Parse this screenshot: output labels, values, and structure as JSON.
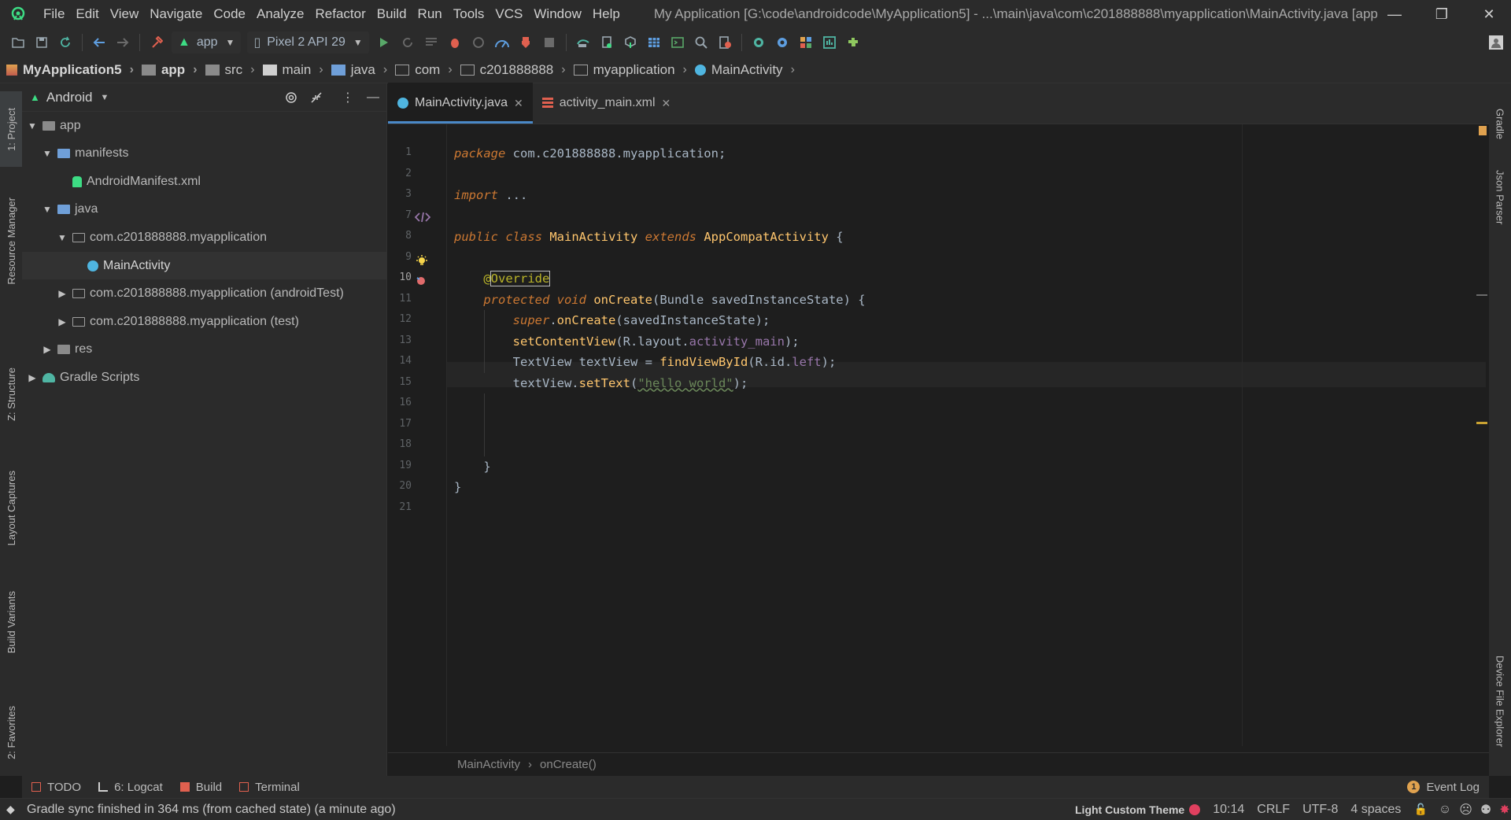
{
  "window": {
    "title": "My Application [G:\\code\\androidcode\\MyApplication5] - ...\\main\\java\\com\\c201888888\\myapplication\\MainActivity.java [app",
    "controls": {
      "minimize": "—",
      "restore": "❐",
      "close": "✕"
    }
  },
  "menu": [
    "File",
    "Edit",
    "View",
    "Navigate",
    "Code",
    "Analyze",
    "Refactor",
    "Build",
    "Run",
    "Tools",
    "VCS",
    "Window",
    "Help"
  ],
  "toolbar": {
    "run_config": "app",
    "device": "Pixel 2 API 29"
  },
  "breadcrumbs": [
    "MyApplication5",
    "app",
    "src",
    "main",
    "java",
    "com",
    "c201888888",
    "myapplication",
    "MainActivity"
  ],
  "left_strip": [
    "1: Project",
    "Resource Manager",
    "Z: Structure",
    "Layout Captures",
    "Build Variants",
    "2: Favorites"
  ],
  "right_strip": [
    "Gradle",
    "Json Parser",
    "Device File Explorer"
  ],
  "project": {
    "view": "Android",
    "tree": [
      {
        "label": "app",
        "depth": 0,
        "arrow": "▼",
        "icon": "folder-gray"
      },
      {
        "label": "manifests",
        "depth": 1,
        "arrow": "▼",
        "icon": "folder-blue"
      },
      {
        "label": "AndroidManifest.xml",
        "depth": 2,
        "arrow": "",
        "icon": "android"
      },
      {
        "label": "java",
        "depth": 1,
        "arrow": "▼",
        "icon": "folder-blue"
      },
      {
        "label": "com.c201888888.myapplication",
        "depth": 2,
        "arrow": "▼",
        "icon": "folder-outline"
      },
      {
        "label": "MainActivity",
        "depth": 3,
        "arrow": "",
        "icon": "class",
        "selected": true
      },
      {
        "label": "com.c201888888.myapplication (androidTest)",
        "depth": 2,
        "arrow": "▶",
        "icon": "folder-outline"
      },
      {
        "label": "com.c201888888.myapplication (test)",
        "depth": 2,
        "arrow": "▶",
        "icon": "folder-outline"
      },
      {
        "label": "res",
        "depth": 1,
        "arrow": "▶",
        "icon": "folder-gray"
      },
      {
        "label": "Gradle Scripts",
        "depth": 0,
        "arrow": "▶",
        "icon": "gradle"
      }
    ]
  },
  "editor": {
    "tabs": [
      {
        "label": "MainActivity.java",
        "active": true
      },
      {
        "label": "activity_main.xml",
        "active": false
      }
    ],
    "current_line": 10,
    "lines": [
      {
        "n": "1",
        "parts": [
          [
            "kw",
            "package"
          ],
          [
            "plain",
            " com.c201888888.myapplication;"
          ]
        ]
      },
      {
        "n": "2",
        "parts": []
      },
      {
        "n": "3",
        "parts": [
          [
            "kw",
            "import"
          ],
          [
            "plain",
            " ..."
          ]
        ]
      },
      {
        "n": "7",
        "parts": []
      },
      {
        "n": "8",
        "parts": [
          [
            "kw",
            "public class"
          ],
          [
            "plain",
            " "
          ],
          [
            "cls",
            "MainActivity"
          ],
          [
            "plain",
            " "
          ],
          [
            "kw",
            "extends"
          ],
          [
            "plain",
            " "
          ],
          [
            "cls",
            "AppCompatActivity"
          ],
          [
            "plain",
            " {"
          ]
        ]
      },
      {
        "n": "9",
        "parts": []
      },
      {
        "n": "10",
        "parts": [
          [
            "ann",
            "    @"
          ],
          [
            "ann",
            "Override"
          ]
        ]
      },
      {
        "n": "11",
        "parts": [
          [
            "kw",
            "    protected void"
          ],
          [
            "plain",
            " "
          ],
          [
            "fn",
            "onCreate"
          ],
          [
            "plain",
            "(Bundle savedInstanceState) {"
          ]
        ]
      },
      {
        "n": "12",
        "parts": [
          [
            "kw",
            "        super"
          ],
          [
            "plain",
            "."
          ],
          [
            "fn",
            "onCreate"
          ],
          [
            "plain",
            "(savedInstanceState);"
          ]
        ]
      },
      {
        "n": "13",
        "parts": [
          [
            "plain",
            "        "
          ],
          [
            "fn",
            "setContentView"
          ],
          [
            "plain",
            "(R.layout."
          ],
          [
            "fld",
            "activity_main"
          ],
          [
            "plain",
            ");"
          ]
        ]
      },
      {
        "n": "14",
        "parts": [
          [
            "plain",
            "        TextView textView = "
          ],
          [
            "fn",
            "findViewById"
          ],
          [
            "plain",
            "(R.id."
          ],
          [
            "fld",
            "left"
          ],
          [
            "plain",
            ");"
          ]
        ]
      },
      {
        "n": "15",
        "parts": [
          [
            "plain",
            "        textView."
          ],
          [
            "fn",
            "setText"
          ],
          [
            "plain",
            "("
          ],
          [
            "str",
            "\"hello world\""
          ],
          [
            "plain",
            ");"
          ]
        ]
      },
      {
        "n": "16",
        "parts": []
      },
      {
        "n": "17",
        "parts": []
      },
      {
        "n": "18",
        "parts": []
      },
      {
        "n": "19",
        "parts": [
          [
            "plain",
            "    }"
          ]
        ]
      },
      {
        "n": "20",
        "parts": [
          [
            "plain",
            "}"
          ]
        ]
      },
      {
        "n": "21",
        "parts": []
      }
    ],
    "breadcrumb": [
      "MainActivity",
      "onCreate()"
    ]
  },
  "bottom_tabs": [
    {
      "label": "TODO",
      "icon": "todo-icon"
    },
    {
      "label": "6: Logcat",
      "icon": "logcat-icon"
    },
    {
      "label": "Build",
      "icon": "build-icon"
    },
    {
      "label": "Terminal",
      "icon": "terminal-icon"
    }
  ],
  "event_log": "Event Log",
  "status": {
    "message": "Gradle sync finished in 364 ms (from cached state) (a minute ago)",
    "theme": "Light Custom Theme",
    "position": "10:14",
    "line_sep": "CRLF",
    "encoding": "UTF-8",
    "indent": "4 spaces"
  },
  "colors": {
    "accent": "#4a88c7",
    "android_green": "#3ddc84",
    "keyword": "#cc7832",
    "string": "#6a8759",
    "function": "#ffc66d"
  }
}
